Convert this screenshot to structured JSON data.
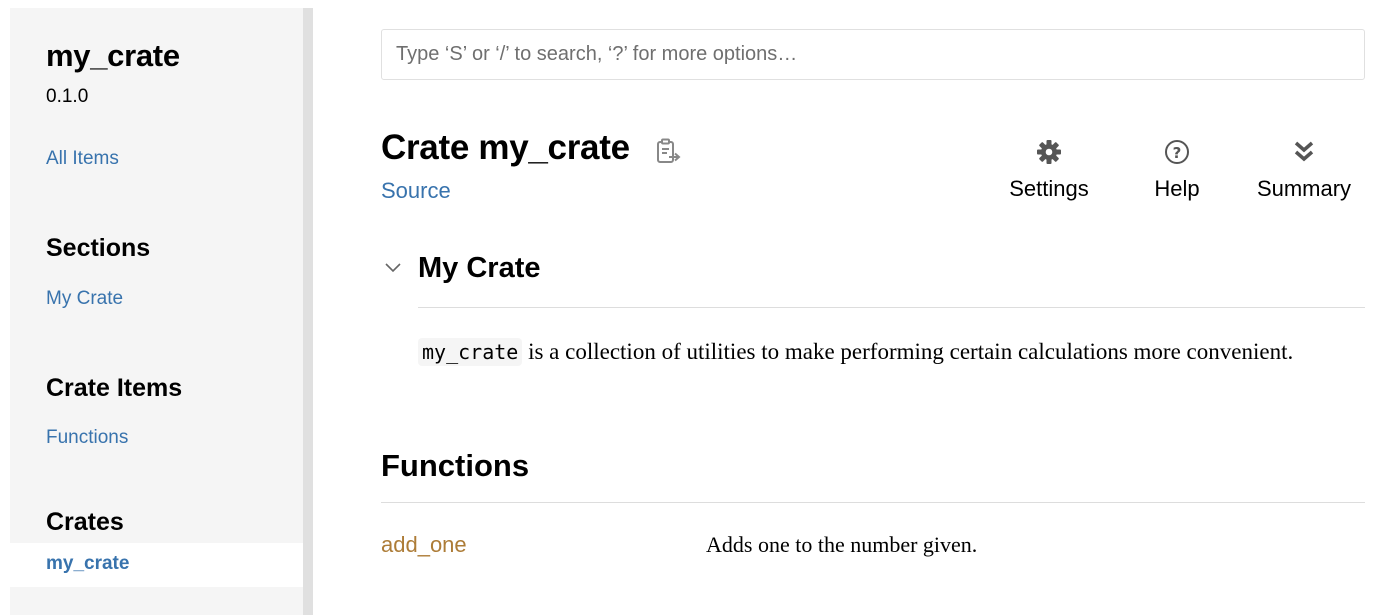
{
  "sidebar": {
    "crate_name": "my_crate",
    "version": "0.1.0",
    "all_items": "All Items",
    "sections_heading": "Sections",
    "sections_link": "My Crate",
    "crate_items_heading": "Crate Items",
    "crate_items_link": "Functions",
    "crates_heading": "Crates",
    "crates_current": "my_crate"
  },
  "search": {
    "placeholder": "Type ‘S’ or ‘/’ to search, ‘?’ for more options…",
    "value": ""
  },
  "header": {
    "title": "Crate my_crate",
    "source": "Source",
    "tools": {
      "settings": "Settings",
      "help": "Help",
      "summary": "Summary"
    }
  },
  "docs": {
    "section_title": "My Crate",
    "code": "my_crate",
    "description": " is a collection of utilities to make performing certain calculations more convenient."
  },
  "functions": {
    "heading": "Functions",
    "items": [
      {
        "name": "add_one",
        "description": "Adds one to the number given."
      }
    ]
  },
  "colors": {
    "link": "#3873ad",
    "function": "#ad7c37",
    "sidebar_bg": "#f5f5f5"
  },
  "icons": {
    "copy": "clipboard-icon",
    "settings": "gear-icon",
    "help": "question-circle-icon",
    "summary": "double-chevron-down-icon",
    "toggle": "chevron-down-icon"
  }
}
